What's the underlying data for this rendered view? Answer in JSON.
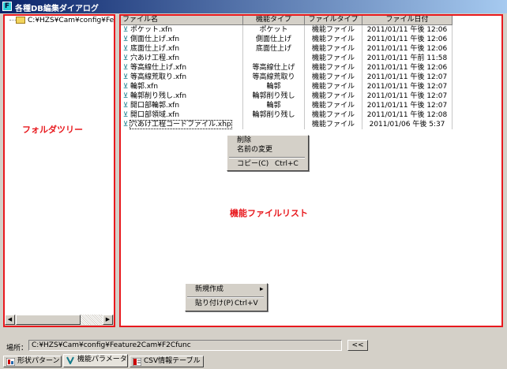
{
  "window": {
    "title": "各種DB編集ダイアログ",
    "app_icon": "F"
  },
  "tree": {
    "root_label": "C:¥HZS¥Cam¥config¥Feature",
    "annotation": "フォルダツリー"
  },
  "list": {
    "annotation": "機能ファイルリスト",
    "columns": [
      "ファイル名",
      "機能タイプ",
      "ファイルタイプ",
      "ファイル日付"
    ],
    "rows": [
      {
        "name": "ポケット.xfn",
        "type": "ポケット",
        "ftype": "機能ファイル",
        "date": "2011/01/11 午後 12:06"
      },
      {
        "name": "側面仕上げ.xfn",
        "type": "側面仕上げ",
        "ftype": "機能ファイル",
        "date": "2011/01/11 午後 12:06"
      },
      {
        "name": "底面仕上げ.xfn",
        "type": "底面仕上げ",
        "ftype": "機能ファイル",
        "date": "2011/01/11 午後 12:06"
      },
      {
        "name": "穴あけ工程.xfn",
        "type": "",
        "ftype": "機能ファイル",
        "date": "2011/01/11 午前 11:58"
      },
      {
        "name": "等高線仕上げ.xfn",
        "type": "等高線仕上げ",
        "ftype": "機能ファイル",
        "date": "2011/01/11 午後 12:06"
      },
      {
        "name": "等高線荒取り.xfn",
        "type": "等高線荒取り",
        "ftype": "機能ファイル",
        "date": "2011/01/11 午後 12:07"
      },
      {
        "name": "輪郭.xfn",
        "type": "輪郭",
        "ftype": "機能ファイル",
        "date": "2011/01/11 午後 12:07"
      },
      {
        "name": "輪郭削り残し.xfn",
        "type": "輪郭削り残し",
        "ftype": "機能ファイル",
        "date": "2011/01/11 午後 12:07"
      },
      {
        "name": "開口部輪郭.xfn",
        "type": "輪郭",
        "ftype": "機能ファイル",
        "date": "2011/01/11 午後 12:07"
      },
      {
        "name": "開口部領域.xfn",
        "type": "輪郭削り残し",
        "ftype": "機能ファイル",
        "date": "2011/01/11 午後 12:08"
      },
      {
        "name": "穴あけ工程コードファイル.xhp",
        "type": "",
        "ftype": "機能ファイル",
        "date": "2011/01/06 午後 5:37"
      }
    ]
  },
  "context_menu_file": {
    "items": [
      "削除",
      "名前の変更"
    ],
    "copy_label": "コピー(C)",
    "copy_shortcut": "Ctrl+C"
  },
  "context_menu_empty": {
    "new_label": "新規作成",
    "submenu_arrow": "▸",
    "paste_label": "貼り付け(P)",
    "paste_shortcut": "Ctrl+V"
  },
  "path": {
    "label": "場所：",
    "value": "C:¥HZS¥Cam¥config¥Feature2Cam¥F2Cfunc",
    "back_label": "<<"
  },
  "tabs": [
    "形状パターン",
    "機能パラメータ",
    "CSV情報テーブル"
  ],
  "icons": {
    "file": "xfn-file-icon",
    "folder": "folder-icon"
  }
}
